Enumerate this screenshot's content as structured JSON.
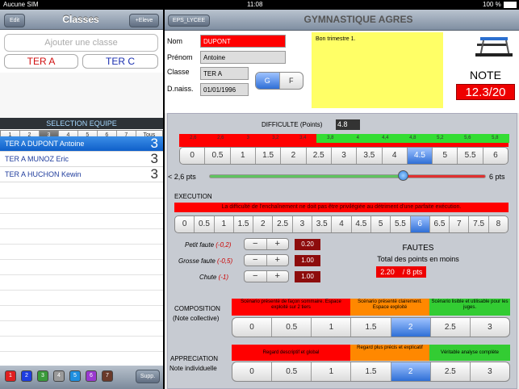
{
  "status": {
    "carrier": "Aucune SIM",
    "time": "11:08",
    "battery": "100 %"
  },
  "left": {
    "edit": "Edit",
    "title": "Classes",
    "add_student": "+Eleve",
    "add_class_placeholder": "Ajouter une classe",
    "classes": [
      "TER A",
      "TER C"
    ],
    "selection_header": "SELECTION  EQUIPE",
    "teams": [
      "1",
      "2",
      "3",
      "4",
      "5",
      "6",
      "7",
      "Tous"
    ],
    "selected_team": "3",
    "students": [
      {
        "name": "TER A DUPONT Antoine",
        "team": "3"
      },
      {
        "name": "TER A MUNOZ Eric",
        "team": "3"
      },
      {
        "name": "TER A HUCHON Kewin",
        "team": "3"
      }
    ],
    "color_buttons": [
      "1",
      "2",
      "3",
      "4",
      "5",
      "6",
      "7"
    ],
    "color_values": [
      "#e02020",
      "#1e3de0",
      "#3a9a3a",
      "#9a9a9a",
      "#1f8fe0",
      "#9a3ad0",
      "#6a3a2a"
    ],
    "supp": "Supp."
  },
  "right": {
    "tab": "EPS_LYCEE",
    "title": "GYMNASTIQUE AGRES",
    "nom_label": "Nom",
    "nom": "DUPONT",
    "prenom_label": "Prénom",
    "prenom": "Antoine",
    "classe_label": "Classe",
    "classe": "TER A",
    "dnaiss_label": "D.naiss.",
    "dnaiss": "01/01/1996",
    "gender": [
      "G",
      "F"
    ],
    "comment": "Bon trimestre 1.",
    "note_label": "NOTE",
    "note": "12.3/20",
    "difficulte": {
      "label": "DIFFICULTE (Points)",
      "value": "4.8",
      "red_ticks": [
        "2,6",
        "2,6",
        "3",
        "3,2",
        "3,4"
      ],
      "green_ticks": [
        "3,8",
        "4",
        "4,4",
        "4,8",
        "5,2",
        "5,6",
        "5,8"
      ],
      "options": [
        "0",
        "0.5",
        "1",
        "1.5",
        "2",
        "2.5",
        "3",
        "3.5",
        "4",
        "4.5",
        "5",
        "5.5",
        "6"
      ],
      "selected": "4.5",
      "slider_min": "< 2,6 pts",
      "slider_max": "6 pts",
      "slider_fraction": 0.7
    },
    "execution": {
      "label": "EXECUTION",
      "hint": "La difficulté de l'enchaînement ne doit pas être privilégiée au détriment d'une parfaite exécution.",
      "options": [
        "0",
        "0.5",
        "1",
        "1.5",
        "2",
        "2.5",
        "3",
        "3.5",
        "4",
        "4.5",
        "5",
        "5.5",
        "6",
        "6.5",
        "7",
        "7.5",
        "8"
      ],
      "selected": "6",
      "petite_label": "Petit faute",
      "petite_pts": "(-0,2)",
      "petite_val": "0.20",
      "grosse_label": "Grosse faute",
      "grosse_pts": "(-0,5)",
      "grosse_val": "1.00",
      "chute_label": "Chute",
      "chute_pts": "(-1)",
      "chute_val": "1.00",
      "fautes_label": "FAUTES",
      "total_label": "Total des points en moins",
      "total": "2.20",
      "total_max": "/ 8 pts"
    },
    "composition": {
      "label": "COMPOSITION",
      "sublabel": "(Note collective)",
      "hints": [
        "Scénario présenté de façon sommaire. Espace exploité sur 2 tiers",
        "Scénario présenté clairement. Espace exploité",
        "Scénario lisible et utilisable pour les juges."
      ],
      "options": [
        "0",
        "0.5",
        "1",
        "1.5",
        "2",
        "2.5",
        "3"
      ],
      "selected": "2"
    },
    "appreciation": {
      "label": "APPRECIATION",
      "sublabel": "Note individuelle",
      "hints": [
        "Regard descriptif et global",
        "Regard plus précis et explicatif",
        "Véritable analyse complète"
      ],
      "options": [
        "0",
        "0.5",
        "1",
        "1.5",
        "2",
        "2.5",
        "3"
      ],
      "selected": "2"
    }
  }
}
